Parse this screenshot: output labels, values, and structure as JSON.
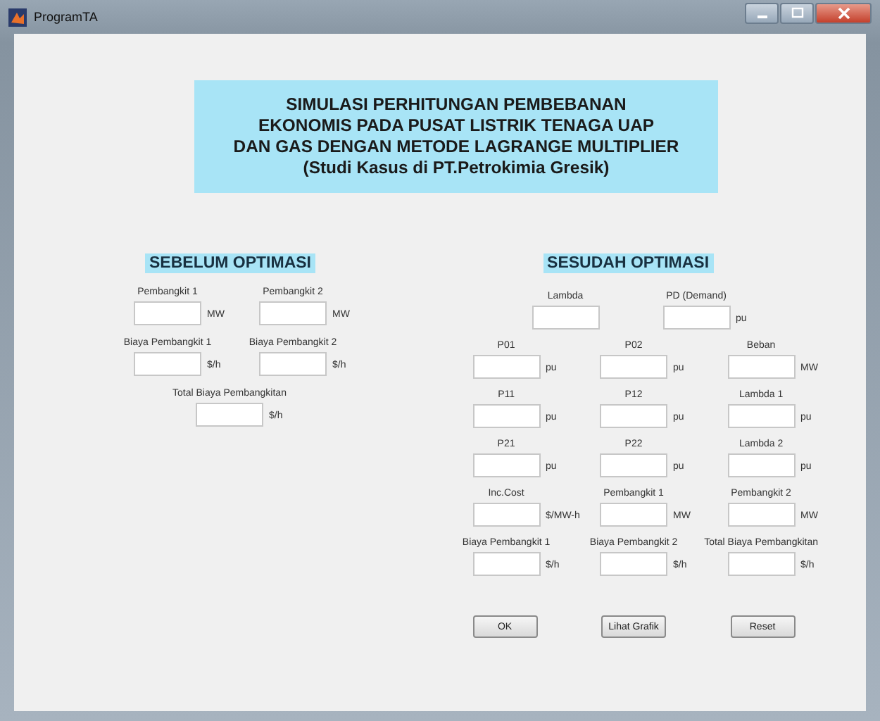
{
  "window": {
    "title": "ProgramTA"
  },
  "banner": {
    "lines": [
      "SIMULASI PERHITUNGAN PEMBEBANAN",
      "EKONOMIS PADA PUSAT LISTRIK TENAGA UAP",
      "DAN GAS DENGAN METODE LAGRANGE MULTIPLIER",
      "(Studi Kasus di PT.Petrokimia Gresik)"
    ]
  },
  "before": {
    "heading": "SEBELUM OPTIMASI",
    "rows": [
      [
        {
          "label": "Pembangkit 1",
          "unit": "MW"
        },
        {
          "label": "Pembangkit 2",
          "unit": "MW"
        }
      ],
      [
        {
          "label": "Biaya Pembangkit 1",
          "unit": "$/h"
        },
        {
          "label": "Biaya Pembangkit 2",
          "unit": "$/h"
        }
      ],
      [
        {
          "label": "Total Biaya Pembangkitan",
          "unit": "$/h"
        }
      ]
    ]
  },
  "after": {
    "heading": "SESUDAH OPTIMASI",
    "top_row": [
      {
        "label": "Lambda"
      },
      {
        "label": "PD (Demand)",
        "unit": "pu"
      }
    ],
    "rows": [
      [
        {
          "label": "P01",
          "unit": "pu"
        },
        {
          "label": "P02",
          "unit": "pu"
        },
        {
          "label": "Beban",
          "unit": "MW"
        }
      ],
      [
        {
          "label": "P11",
          "unit": "pu"
        },
        {
          "label": "P12",
          "unit": "pu"
        },
        {
          "label": "Lambda 1",
          "unit": "pu"
        }
      ],
      [
        {
          "label": "P21",
          "unit": "pu"
        },
        {
          "label": "P22",
          "unit": "pu"
        },
        {
          "label": "Lambda 2",
          "unit": "pu"
        }
      ],
      [
        {
          "label": "Inc.Cost",
          "unit": "$/MW-h"
        },
        {
          "label": "Pembangkit 1",
          "unit": "MW"
        },
        {
          "label": "Pembangkit 2",
          "unit": "MW"
        }
      ],
      [
        {
          "label": "Biaya Pembangkit 1",
          "unit": "$/h"
        },
        {
          "label": "Biaya Pembangkit 2",
          "unit": "$/h"
        },
        {
          "label": "Total Biaya Pembangkitan",
          "unit": "$/h"
        }
      ]
    ]
  },
  "buttons": [
    "OK",
    "Lihat Grafik",
    "Reset"
  ]
}
